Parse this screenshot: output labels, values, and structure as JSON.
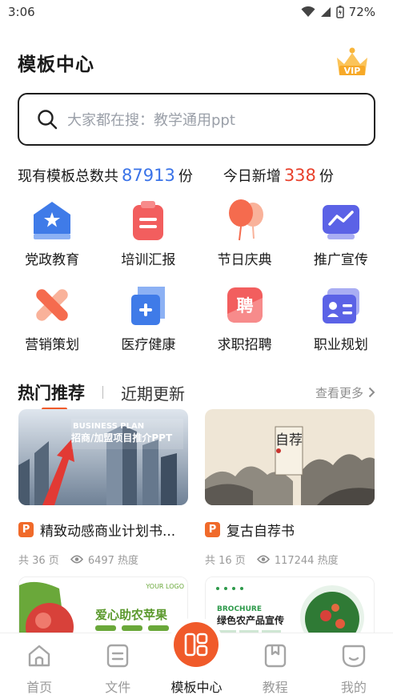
{
  "status": {
    "time": "3:06",
    "battery": "72%"
  },
  "header": {
    "title": "模板中心",
    "vip_text": "VIP"
  },
  "search": {
    "placeholder": "大家都在搜：教学通用ppt"
  },
  "stats": {
    "total_prefix": "现有模板总数共",
    "total_count": "87913",
    "total_unit": "份",
    "today_prefix": "今日新增",
    "today_count": "338",
    "today_unit": "份"
  },
  "categories": [
    {
      "label": "党政教育",
      "icon": "party-building-icon"
    },
    {
      "label": "培训汇报",
      "icon": "clipboard-icon"
    },
    {
      "label": "节日庆典",
      "icon": "balloon-icon"
    },
    {
      "label": "推广宣传",
      "icon": "chart-board-icon"
    },
    {
      "label": "营销策划",
      "icon": "cross-icon"
    },
    {
      "label": "医疗健康",
      "icon": "medical-icon"
    },
    {
      "label": "求职招聘",
      "icon": "hire-icon"
    },
    {
      "label": "职业规划",
      "icon": "id-card-icon"
    }
  ],
  "tabs": {
    "active": "热门推荐",
    "other": "近期更新",
    "see_more": "查看更多"
  },
  "cards": [
    {
      "title": "精致动感商业计划书...",
      "pages": "共 36 页",
      "heat": "6497 热度",
      "thumb_heading": "BUSINESS PLAN",
      "thumb_sub": "招商/加盟项目推介PPT"
    },
    {
      "title": "复古自荐书",
      "pages": "共 16 页",
      "heat": "117244 热度",
      "thumb_heading": "自荐"
    }
  ],
  "lower_cards": [
    {
      "logo_text": "YOUR LOGO",
      "heading": "爱心助农苹果"
    },
    {
      "heading_en": "BROCHURE",
      "heading": "绿色农产品宣传"
    }
  ],
  "nav": [
    {
      "label": "首页",
      "icon": "home-icon"
    },
    {
      "label": "文件",
      "icon": "file-icon"
    },
    {
      "label": "模板中心",
      "icon": "template-icon",
      "active": true
    },
    {
      "label": "教程",
      "icon": "tutorial-icon"
    },
    {
      "label": "我的",
      "icon": "profile-icon"
    }
  ],
  "colors": {
    "accent": "#f05a2a",
    "blue": "#3a73e8",
    "red": "#e8412c"
  }
}
